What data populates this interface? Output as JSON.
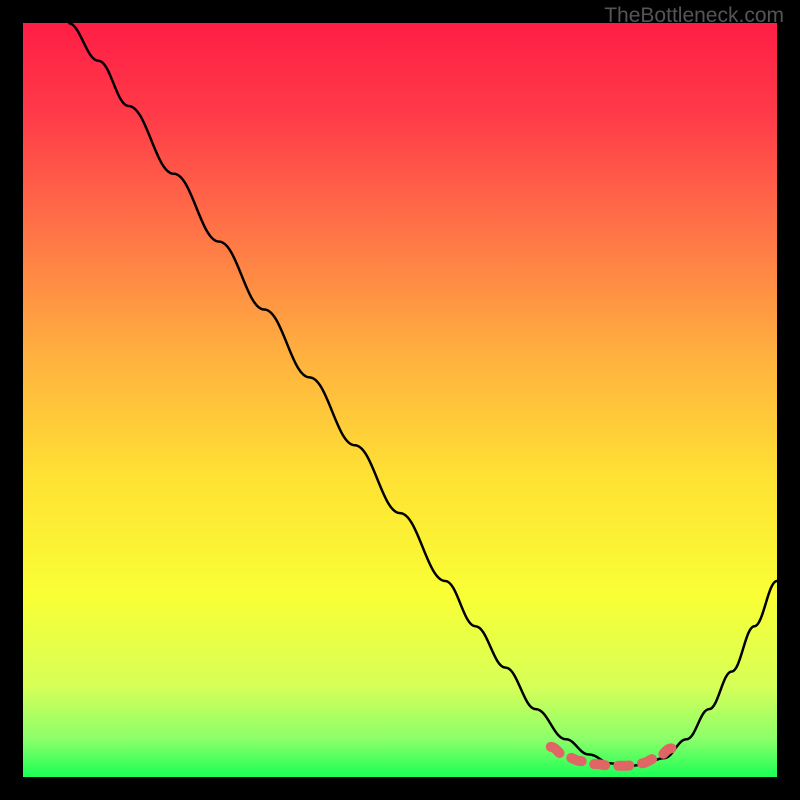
{
  "watermark": "TheBottleneck.com",
  "chart_data": {
    "type": "line",
    "title": "",
    "xlabel": "",
    "ylabel": "",
    "xlim": [
      0,
      100
    ],
    "ylim": [
      0,
      100
    ],
    "series": [
      {
        "name": "bottleneck-curve",
        "x": [
          6,
          10,
          14,
          20,
          26,
          32,
          38,
          44,
          50,
          56,
          60,
          64,
          68,
          72,
          75,
          78,
          80,
          82,
          85,
          88,
          91,
          94,
          97,
          100
        ],
        "y": [
          100,
          95,
          89,
          80,
          71,
          62,
          53,
          44,
          35,
          26,
          20,
          14.5,
          9,
          5,
          3,
          1.8,
          1.4,
          1.6,
          2.5,
          5,
          9,
          14,
          20,
          26
        ]
      },
      {
        "name": "optimal-range-marker",
        "x": [
          70,
          72,
          74,
          76,
          78,
          80,
          82,
          84,
          86
        ],
        "y": [
          4.0,
          2.7,
          2.1,
          1.7,
          1.5,
          1.5,
          1.8,
          2.5,
          3.8
        ]
      }
    ],
    "gradient_stops": [
      {
        "offset": 0.0,
        "color": "#ff1e45"
      },
      {
        "offset": 0.12,
        "color": "#ff3a49"
      },
      {
        "offset": 0.28,
        "color": "#ff7547"
      },
      {
        "offset": 0.44,
        "color": "#ffb03f"
      },
      {
        "offset": 0.6,
        "color": "#ffe134"
      },
      {
        "offset": 0.76,
        "color": "#f9ff35"
      },
      {
        "offset": 0.88,
        "color": "#d6ff58"
      },
      {
        "offset": 0.95,
        "color": "#8bff6a"
      },
      {
        "offset": 1.0,
        "color": "#1aff55"
      }
    ]
  }
}
